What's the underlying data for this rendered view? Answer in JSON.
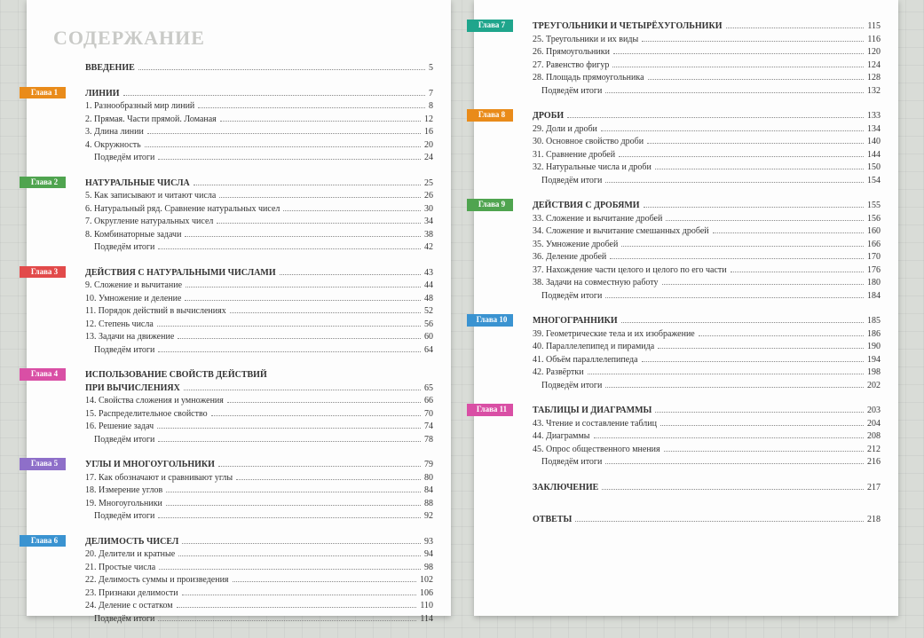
{
  "title": "СОДЕРЖАНИЕ",
  "tabPrefix": "Глава",
  "colors": {
    "1": "#e98b1a",
    "2": "#4fa44f",
    "3": "#e24a4a",
    "4": "#d94fa5",
    "5": "#8e6fc9",
    "6": "#3a93d1",
    "7": "#1fa58c",
    "8": "#e98b1a",
    "9": "#4fa44f",
    "10": "#3a93d1",
    "11": "#d94fa5"
  },
  "left": [
    {
      "kind": "head",
      "label": "ВВЕДЕНИЕ",
      "page": "5"
    },
    {
      "kind": "chapter",
      "num": "1",
      "label": "ЛИНИИ",
      "page": "7"
    },
    {
      "kind": "item",
      "label": "1. Разнообразный мир линий",
      "page": "8"
    },
    {
      "kind": "item",
      "label": "2. Прямая. Части прямой. Ломаная",
      "page": "12"
    },
    {
      "kind": "item",
      "label": "3. Длина линии",
      "page": "16"
    },
    {
      "kind": "item",
      "label": "4. Окружность",
      "page": "20"
    },
    {
      "kind": "item",
      "label": "    Подведём итоги",
      "page": "24"
    },
    {
      "kind": "chapter",
      "num": "2",
      "label": "НАТУРАЛЬНЫЕ ЧИСЛА",
      "page": "25"
    },
    {
      "kind": "item",
      "label": "5. Как записывают и читают числа",
      "page": "26"
    },
    {
      "kind": "item",
      "label": "6. Натуральный ряд. Сравнение натуральных чисел",
      "page": "30"
    },
    {
      "kind": "item",
      "label": "7. Округление натуральных чисел",
      "page": "34"
    },
    {
      "kind": "item",
      "label": "8. Комбинаторные задачи",
      "page": "38"
    },
    {
      "kind": "item",
      "label": "    Подведём итоги",
      "page": "42"
    },
    {
      "kind": "chapter",
      "num": "3",
      "label": "ДЕЙСТВИЯ С НАТУРАЛЬНЫМИ ЧИСЛАМИ",
      "page": "43"
    },
    {
      "kind": "item",
      "label": "9. Сложение и вычитание",
      "page": "44"
    },
    {
      "kind": "item",
      "label": "10. Умножение и деление",
      "page": "48"
    },
    {
      "kind": "item",
      "label": "11. Порядок действий в вычислениях",
      "page": "52"
    },
    {
      "kind": "item",
      "label": "12. Степень числа",
      "page": "56"
    },
    {
      "kind": "item",
      "label": "13. Задачи на движение",
      "page": "60"
    },
    {
      "kind": "item",
      "label": "    Подведём итоги",
      "page": "64"
    },
    {
      "kind": "chapter",
      "num": "4",
      "label": "ИСПОЛЬЗОВАНИЕ СВОЙСТВ ДЕЙСТВИЙ",
      "page": ""
    },
    {
      "kind": "head2",
      "label": "ПРИ ВЫЧИСЛЕНИЯХ",
      "page": "65"
    },
    {
      "kind": "item",
      "label": "14. Свойства сложения и умножения",
      "page": "66"
    },
    {
      "kind": "item",
      "label": "15. Распределительное свойство",
      "page": "70"
    },
    {
      "kind": "item",
      "label": "16. Решение задач",
      "page": "74"
    },
    {
      "kind": "item",
      "label": "    Подведём итоги",
      "page": "78"
    },
    {
      "kind": "chapter",
      "num": "5",
      "label": "УГЛЫ И МНОГОУГОЛЬНИКИ",
      "page": "79"
    },
    {
      "kind": "item",
      "label": "17. Как обозначают и сравнивают углы",
      "page": "80"
    },
    {
      "kind": "item",
      "label": "18. Измерение углов",
      "page": "84"
    },
    {
      "kind": "item",
      "label": "19. Многоугольники",
      "page": "88"
    },
    {
      "kind": "item",
      "label": "    Подведём итоги",
      "page": "92"
    },
    {
      "kind": "chapter",
      "num": "6",
      "label": "ДЕЛИМОСТЬ ЧИСЕЛ",
      "page": "93"
    },
    {
      "kind": "item",
      "label": "20. Делители и кратные",
      "page": "94"
    },
    {
      "kind": "item",
      "label": "21. Простые числа",
      "page": "98"
    },
    {
      "kind": "item",
      "label": "22. Делимость суммы и произведения",
      "page": "102"
    },
    {
      "kind": "item",
      "label": "23. Признаки делимости",
      "page": "106"
    },
    {
      "kind": "item",
      "label": "24. Деление с остатком",
      "page": "110"
    },
    {
      "kind": "item",
      "label": "    Подведём итоги",
      "page": "114"
    }
  ],
  "right": [
    {
      "kind": "chapter",
      "num": "7",
      "label": "ТРЕУГОЛЬНИКИ И ЧЕТЫРЁХУГОЛЬНИКИ",
      "page": "115"
    },
    {
      "kind": "item",
      "label": "25. Треугольники и их виды",
      "page": "116"
    },
    {
      "kind": "item",
      "label": "26. Прямоугольники",
      "page": "120"
    },
    {
      "kind": "item",
      "label": "27. Равенство фигур",
      "page": "124"
    },
    {
      "kind": "item",
      "label": "28. Площадь прямоугольника",
      "page": "128"
    },
    {
      "kind": "item",
      "label": "    Подведём итоги",
      "page": "132"
    },
    {
      "kind": "chapter",
      "num": "8",
      "label": "ДРОБИ",
      "page": "133"
    },
    {
      "kind": "item",
      "label": "29. Доли и дроби",
      "page": "134"
    },
    {
      "kind": "item",
      "label": "30. Основное свойство дроби",
      "page": "140"
    },
    {
      "kind": "item",
      "label": "31. Сравнение дробей",
      "page": "144"
    },
    {
      "kind": "item",
      "label": "32. Натуральные числа и дроби",
      "page": "150"
    },
    {
      "kind": "item",
      "label": "    Подведём итоги",
      "page": "154"
    },
    {
      "kind": "chapter",
      "num": "9",
      "label": "ДЕЙСТВИЯ С ДРОБЯМИ",
      "page": "155"
    },
    {
      "kind": "item",
      "label": "33. Сложение и вычитание дробей",
      "page": "156"
    },
    {
      "kind": "item",
      "label": "34. Сложение и вычитание смешанных дробей",
      "page": "160"
    },
    {
      "kind": "item",
      "label": "35. Умножение дробей",
      "page": "166"
    },
    {
      "kind": "item",
      "label": "36. Деление дробей",
      "page": "170"
    },
    {
      "kind": "item",
      "label": "37. Нахождение части целого и целого по его части",
      "page": "176"
    },
    {
      "kind": "item",
      "label": "38. Задачи на совместную работу",
      "page": "180"
    },
    {
      "kind": "item",
      "label": "    Подведём итоги",
      "page": "184"
    },
    {
      "kind": "chapter",
      "num": "10",
      "label": "МНОГОГРАННИКИ",
      "page": "185"
    },
    {
      "kind": "item",
      "label": "39. Геометрические тела и их изображение",
      "page": "186"
    },
    {
      "kind": "item",
      "label": "40. Параллелепипед и пирамида",
      "page": "190"
    },
    {
      "kind": "item",
      "label": "41. Объём параллелепипеда",
      "page": "194"
    },
    {
      "kind": "item",
      "label": "42. Развёртки",
      "page": "198"
    },
    {
      "kind": "item",
      "label": "    Подведём итоги",
      "page": "202"
    },
    {
      "kind": "chapter",
      "num": "11",
      "label": "ТАБЛИЦЫ И ДИАГРАММЫ",
      "page": "203"
    },
    {
      "kind": "item",
      "label": "43. Чтение и составление таблиц",
      "page": "204"
    },
    {
      "kind": "item",
      "label": "44. Диаграммы",
      "page": "208"
    },
    {
      "kind": "item",
      "label": "45. Опрос общественного мнения",
      "page": "212"
    },
    {
      "kind": "item",
      "label": "    Подведём итоги",
      "page": "216"
    },
    {
      "kind": "head",
      "label": "ЗАКЛЮЧЕНИЕ",
      "page": "217"
    },
    {
      "kind": "spacer"
    },
    {
      "kind": "head",
      "label": "ОТВЕТЫ",
      "page": "218"
    }
  ]
}
